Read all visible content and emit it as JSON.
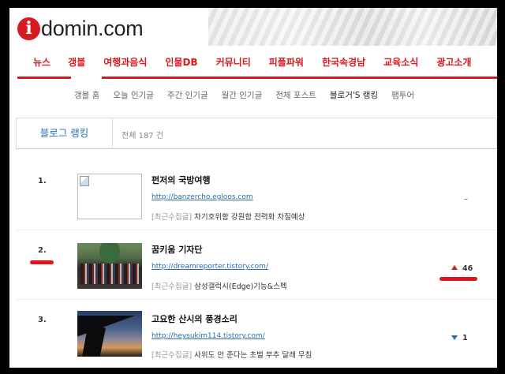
{
  "logo": {
    "letter": "i",
    "text": "domin.com"
  },
  "nav": {
    "items": [
      "뉴스",
      "갱블",
      "여행과음식",
      "인물DB",
      "커뮤니티",
      "피플파워",
      "한국속경남",
      "교육소식",
      "광고소개"
    ]
  },
  "subnav": {
    "items": [
      "갱블 홈",
      "오늘 인기글",
      "주간 인기글",
      "월간 인기글",
      "전체 포스트",
      "블로거'S 랭킹",
      "팸투어"
    ],
    "active": "블로거'S 랭킹"
  },
  "ranking": {
    "tab_label": "블로그 랭킹",
    "total": "전체 187 건",
    "rows": [
      {
        "rank": "1.",
        "title": "펀저의 국방여행",
        "url": "http://banzercho.egloos.com",
        "recent_tag": "[최근수집글]",
        "recent_title": "차기호위함 강원함 전력화 차질예상",
        "trend": "–",
        "trend_dir": "none"
      },
      {
        "rank": "2.",
        "title": "꿈키움 기자단",
        "url": "http://dreamreporter.tistory.com/",
        "recent_tag": "[최근수집글]",
        "recent_title": "삼성갤럭시(Edge)기능&스펙",
        "trend": "46",
        "trend_dir": "up"
      },
      {
        "rank": "3.",
        "title": "고요한 산시의 풍경소리",
        "url": "http://heysukim114.tistory.com/",
        "recent_tag": "[최근수집글]",
        "recent_title": "사위도 안 준다는 초벌 부추 달래 무침",
        "trend": "1",
        "trend_dir": "down"
      }
    ]
  },
  "colors": {
    "brand": "#d71920",
    "link": "#2a6db5",
    "highlight_mark": "#e0161e"
  }
}
